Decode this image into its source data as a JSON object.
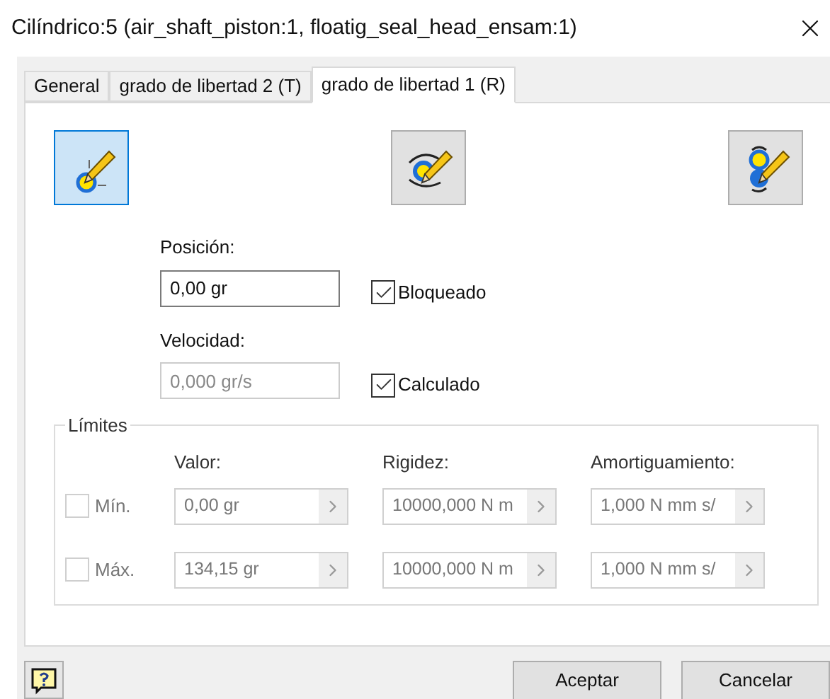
{
  "window": {
    "title": "Cilíndrico:5 (air_shaft_piston:1, floatig_seal_head_ensam:1)"
  },
  "tabs": [
    {
      "label": "General",
      "selected": false
    },
    {
      "label": "grado de libertad 2 (T)",
      "selected": false
    },
    {
      "label": "grado de libertad 1 (R)",
      "selected": true
    }
  ],
  "mode_buttons": [
    {
      "kind": "position",
      "selected": true
    },
    {
      "kind": "rotation",
      "selected": false
    },
    {
      "kind": "stack",
      "selected": false
    }
  ],
  "fields": [
    {
      "label": "Posición:",
      "value": "0,00 gr",
      "disabled": false,
      "option": {
        "label": "Bloqueado",
        "checked": true
      }
    },
    {
      "label": "Velocidad:",
      "value": "0,000 gr/s",
      "disabled": true,
      "option": {
        "label": "Calculado",
        "checked": true
      }
    }
  ],
  "limits": {
    "title": "Límites",
    "columns": [
      "Valor:",
      "Rigidez:",
      "Amortiguamiento:"
    ],
    "rows": [
      {
        "label": "Mín.",
        "checked": false,
        "values": [
          "0,00 gr",
          "10000,000 N m",
          "1,000 N mm s/"
        ]
      },
      {
        "label": "Máx.",
        "checked": false,
        "values": [
          "134,15 gr",
          "10000,000 N m",
          "1,000 N mm s/"
        ]
      }
    ]
  },
  "buttons": [
    "Aceptar",
    "Cancelar"
  ]
}
